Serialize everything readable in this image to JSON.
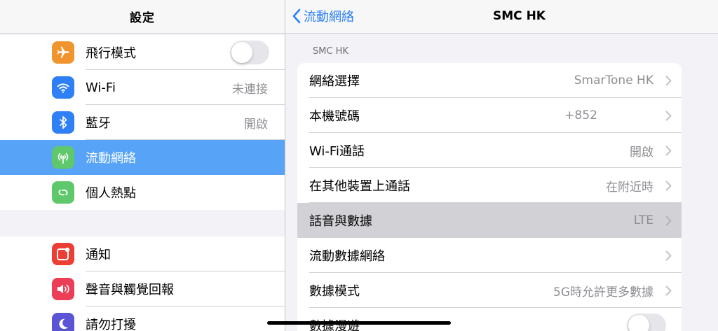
{
  "sidebar": {
    "title": "設定",
    "group1": [
      {
        "label": "飛行模式",
        "icon": "airplane-icon",
        "color": "#f0952e",
        "toggle": "off"
      },
      {
        "label": "Wi-Fi",
        "value": "未連接",
        "icon": "wifi-icon",
        "color": "#2f7ff6"
      },
      {
        "label": "藍牙",
        "value": "開啟",
        "icon": "bluetooth-icon",
        "color": "#2f7ff6"
      },
      {
        "label": "流動網絡",
        "icon": "antenna-icon",
        "color": "#5ec86a",
        "selected": true
      },
      {
        "label": "個人熱點",
        "icon": "hotspot-icon",
        "color": "#5ec86a"
      }
    ],
    "group2": [
      {
        "label": "通知",
        "icon": "notification-icon",
        "color": "#ec3e34"
      },
      {
        "label": "聲音與觸覺回報",
        "icon": "speaker-icon",
        "color": "#ec3e56"
      },
      {
        "label": "請勿打擾",
        "icon": "moon-icon",
        "color": "#5b55d6"
      }
    ]
  },
  "detail": {
    "back_label": "流動網絡",
    "title": "SMC HK",
    "section_header": "SMC HK",
    "rows": [
      {
        "label": "網絡選擇",
        "value": "SmarTone HK"
      },
      {
        "label": "本機號碼",
        "value": "+852"
      },
      {
        "label": "Wi-Fi通話",
        "value": "開啟"
      },
      {
        "label": "在其他裝置上通話",
        "value": "在附近時"
      },
      {
        "label": "話音與數據",
        "value": "LTE",
        "highlighted": true
      },
      {
        "label": "流動數據網絡",
        "value": ""
      },
      {
        "label": "數據模式",
        "value": "5G時允許更多數據"
      },
      {
        "label": "數據漫遊",
        "toggle": "off"
      }
    ]
  },
  "colors": {
    "accent": "#2b7ff6",
    "selected_row": "#57a3f7",
    "highlight_row": "#d1d1d6"
  }
}
